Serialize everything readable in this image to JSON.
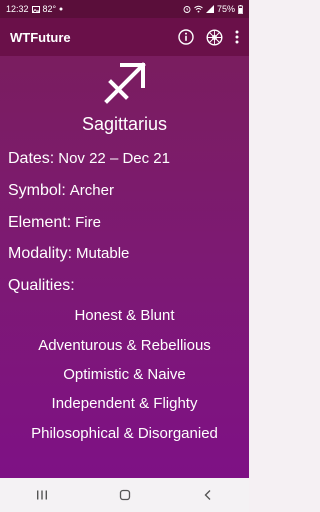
{
  "status_bar": {
    "time": "12:32",
    "temperature": "82°",
    "battery": "75%"
  },
  "app_bar": {
    "title": "WTFuture",
    "icons": [
      "info-icon",
      "settings-wheel-icon",
      "more-vertical-icon"
    ]
  },
  "sign": {
    "symbol_icon": "sagittarius-arrow-icon",
    "name": "Sagittarius"
  },
  "details": {
    "dates_label": "Dates:",
    "dates_value": "Nov 22 – Dec 21",
    "symbol_label": "Symbol:",
    "symbol_value": "Archer",
    "element_label": "Element:",
    "element_value": "Fire",
    "modality_label": "Modality:",
    "modality_value": "Mutable",
    "qualities_label": "Qualities:"
  },
  "qualities": [
    "Honest & Blunt",
    "Adventurous & Rebellious",
    "Optimistic & Naive",
    "Independent & Flighty",
    "Philosophical & Disorganied"
  ],
  "nav_bar": {
    "icons": [
      "recent-apps-icon",
      "home-icon",
      "back-icon"
    ]
  },
  "colors": {
    "status_bar": "#5a0e3a",
    "app_bar": "#6a1049",
    "gradient_top": "#7a1d5f",
    "gradient_bottom": "#7e1185",
    "text": "#ffffff"
  }
}
